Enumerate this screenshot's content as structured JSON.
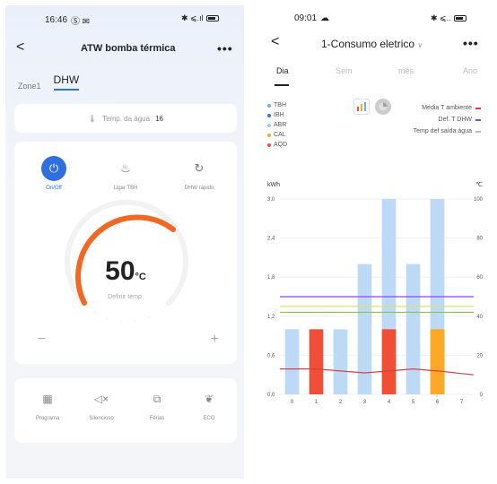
{
  "left": {
    "status": {
      "time": "16:46",
      "icons": "Ⓢ ✉",
      "right": "✱ ⩽.ıl"
    },
    "nav": {
      "back": "<",
      "title": "ATW bomba térmica",
      "more": "•••"
    },
    "zone_tabs": [
      {
        "label": "Zone1",
        "active": false
      },
      {
        "label": "DHW",
        "active": true
      }
    ],
    "temp_card": {
      "label": "Temp. da água",
      "value": "16"
    },
    "controls": [
      {
        "label": "On/Off",
        "icon": "power-icon",
        "glyph": "⏻",
        "active": true
      },
      {
        "label": "Ligar TBH",
        "icon": "heater-icon",
        "glyph": "♨",
        "active": false
      },
      {
        "label": "DHW rápido",
        "icon": "boost-icon",
        "glyph": "↻",
        "active": false
      }
    ],
    "dial": {
      "value": "50",
      "unit": "°C",
      "sub": "Definir temp.",
      "minus": "−",
      "plus": "+"
    },
    "modes": [
      {
        "label": "Programa",
        "icon": "calendar-icon",
        "glyph": "▦"
      },
      {
        "label": "Silencioso",
        "icon": "speaker-icon",
        "glyph": "◁×"
      },
      {
        "label": "Férias",
        "icon": "vacation-icon",
        "glyph": "⧉"
      },
      {
        "label": "ECO",
        "icon": "leaf-icon",
        "glyph": "❦"
      }
    ]
  },
  "right": {
    "status": {
      "time": "09:01",
      "icons": "☁",
      "right": "✱ ⩽.. "
    },
    "nav": {
      "back": "<",
      "title": "1-Consumo eletrico",
      "dropdown": "∨",
      "more": "•••"
    },
    "period_tabs": [
      {
        "label": "Dia",
        "active": true
      },
      {
        "label": "Sem",
        "active": false
      },
      {
        "label": "mês",
        "active": false
      },
      {
        "label": "Ano",
        "active": false
      }
    ],
    "legend": [
      {
        "label": "TBH",
        "color": "#6fb0ea"
      },
      {
        "label": "IBH",
        "color": "#2f6fe0"
      },
      {
        "label": "ABR",
        "color": "#9fc9f0"
      },
      {
        "label": "CAL",
        "color": "#ffa726"
      },
      {
        "label": "AQD",
        "color": "#f04e37"
      }
    ],
    "line_legend": [
      {
        "label": "Média T ambiente",
        "color": "#e53935"
      },
      {
        "label": "Def. T DHW",
        "color": "#8e44ec"
      },
      {
        "label": "Temp def saída água",
        "color": "#bbbbbb"
      }
    ],
    "chart_data": {
      "type": "bar",
      "ylabel": "kWh",
      "y2label": "℃",
      "ylim": [
        0,
        3.0
      ],
      "y2lim": [
        0,
        100
      ],
      "yticks": [
        "0,0",
        "0,6",
        "1,2",
        "1,8",
        "2,4",
        "3,0"
      ],
      "y2ticks": [
        "0",
        "20",
        "40",
        "60",
        "80",
        "100"
      ],
      "categories": [
        "0",
        "1",
        "2",
        "3",
        "4",
        "5",
        "6",
        "7"
      ],
      "series": [
        {
          "name": "ABR",
          "color": "#bcd9f5",
          "values": [
            1.0,
            0.0,
            1.0,
            2.0,
            3.0,
            2.0,
            3.0,
            0.0
          ]
        },
        {
          "name": "AQD",
          "color": "#f04e37",
          "values": [
            0,
            1.0,
            0,
            0,
            1.0,
            0,
            0,
            0
          ]
        },
        {
          "name": "CAL",
          "color": "#ffa726",
          "values": [
            0,
            0,
            0,
            0,
            0,
            0,
            1.0,
            0
          ]
        }
      ],
      "lines": [
        {
          "name": "Média T ambiente",
          "color": "#d94040",
          "values": [
            13,
            13,
            12,
            11,
            12,
            13,
            12,
            10
          ]
        },
        {
          "name": "Def. T DHW",
          "color": "#8e44ec",
          "values": [
            50,
            50,
            50,
            50,
            50,
            50,
            50,
            50
          ]
        },
        {
          "name": "Temp def saída água",
          "color": "#8bc34a",
          "values": [
            42,
            42,
            42,
            42,
            42,
            42,
            42,
            42
          ]
        },
        {
          "name": "Temp def saída água 2",
          "color": "#d6e56a",
          "values": [
            45,
            45,
            45,
            45,
            45,
            45,
            45,
            45
          ]
        }
      ]
    }
  }
}
